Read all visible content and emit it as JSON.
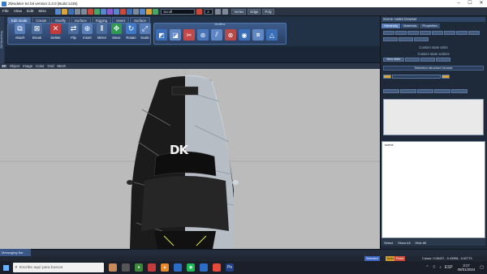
{
  "window": {
    "title": "ZModeler 64 bit version 3.3.0 (Build 1235)",
    "controls": [
      "–",
      "☐",
      "✕"
    ]
  },
  "menu": [
    "File",
    "View",
    "Edit",
    "Misc"
  ],
  "toolbar_combo": "Scroll",
  "toolbar_number": "2",
  "toolbar_buttons": [
    "Vertex",
    "Edge",
    "Poly"
  ],
  "ribbon": {
    "vertical_tab": "ZM Modelling",
    "tabs": [
      "Edit mode",
      "Create",
      "Modify",
      "Surface",
      "Rigging",
      "Insert",
      "Surface"
    ],
    "active_tab": 0,
    "tools": [
      "Attach",
      "Break",
      "Delete",
      "Flip",
      "Insert",
      "Mirror",
      "Move",
      "Rotate",
      "Scale"
    ],
    "group_title": "Modifiers"
  },
  "viewport": {
    "label": "3D",
    "menu": [
      "Object",
      "Image",
      "Color",
      "Grid",
      "Mesh"
    ],
    "car_text": "DK"
  },
  "right_panel": {
    "title": "Scene nodes browser",
    "tabs": [
      "Hierarchy",
      "Materials",
      "Properties"
    ],
    "active_tab": 0,
    "custom_state": "Custom state visits",
    "custom_action": "Custom state actions",
    "new_state_button": "New state",
    "selection_header": "Selection structure browse",
    "tree_root": "scene",
    "bottom_buttons": [
      "Show All",
      "Hide All"
    ],
    "tree_select_label": "Select"
  },
  "status": {
    "message_tab": "Messaging Bar",
    "selected": "Selected",
    "auto": "Auto",
    "fixed": "Fixed",
    "coords": "Cursor: 0.06437, -0.43398, -0.02773"
  },
  "taskbar": {
    "search_placeholder": "Escribe aquí para buscar",
    "lang": "ESP",
    "time": "3:17",
    "date": "08/01/2024"
  }
}
